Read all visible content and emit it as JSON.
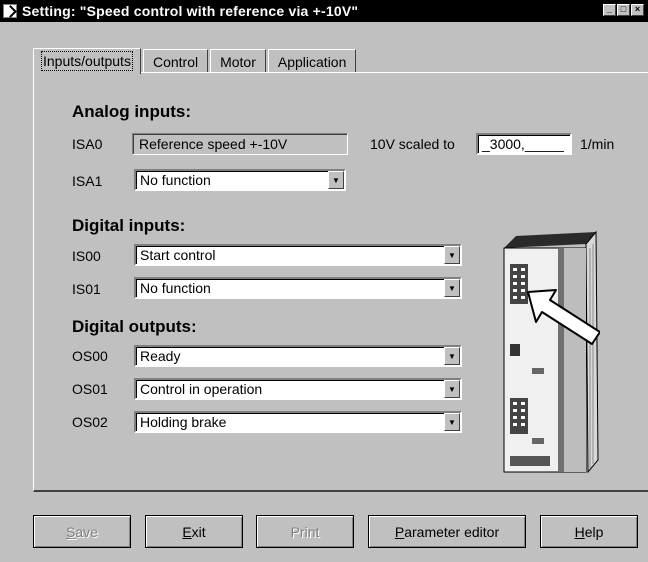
{
  "window": {
    "title": "Setting: \"Speed control with reference via +-10V\"",
    "buttons": [
      "_",
      "□",
      "×"
    ]
  },
  "tabs": [
    {
      "label": "Inputs/outputs",
      "active": true
    },
    {
      "label": "Control",
      "active": false
    },
    {
      "label": "Motor",
      "active": false
    },
    {
      "label": "Application",
      "active": false
    }
  ],
  "analog": {
    "heading": "Analog inputs:",
    "isa0": {
      "label": "ISA0",
      "value": "Reference speed +-10V",
      "scaled_label": "10V scaled to",
      "scaled_value": "_3000,_____",
      "unit": "1/min"
    },
    "isa1": {
      "label": "ISA1",
      "value": "No function"
    }
  },
  "digital_in": {
    "heading": "Digital inputs:",
    "is00": {
      "label": "IS00",
      "value": "Start control"
    },
    "is01": {
      "label": "IS01",
      "value": "No function"
    }
  },
  "digital_out": {
    "heading": "Digital outputs:",
    "os00": {
      "label": "OS00",
      "value": "Ready"
    },
    "os01": {
      "label": "OS01",
      "value": "Control in operation"
    },
    "os02": {
      "label": "OS02",
      "value": "Holding brake"
    }
  },
  "buttons": {
    "save": {
      "u": "S",
      "rest": "ave"
    },
    "exit": {
      "u": "E",
      "rest": "xit"
    },
    "print": {
      "label": "Print"
    },
    "param": {
      "u": "P",
      "rest": "arameter editor"
    },
    "help": {
      "u": "H",
      "rest": "elp"
    }
  }
}
